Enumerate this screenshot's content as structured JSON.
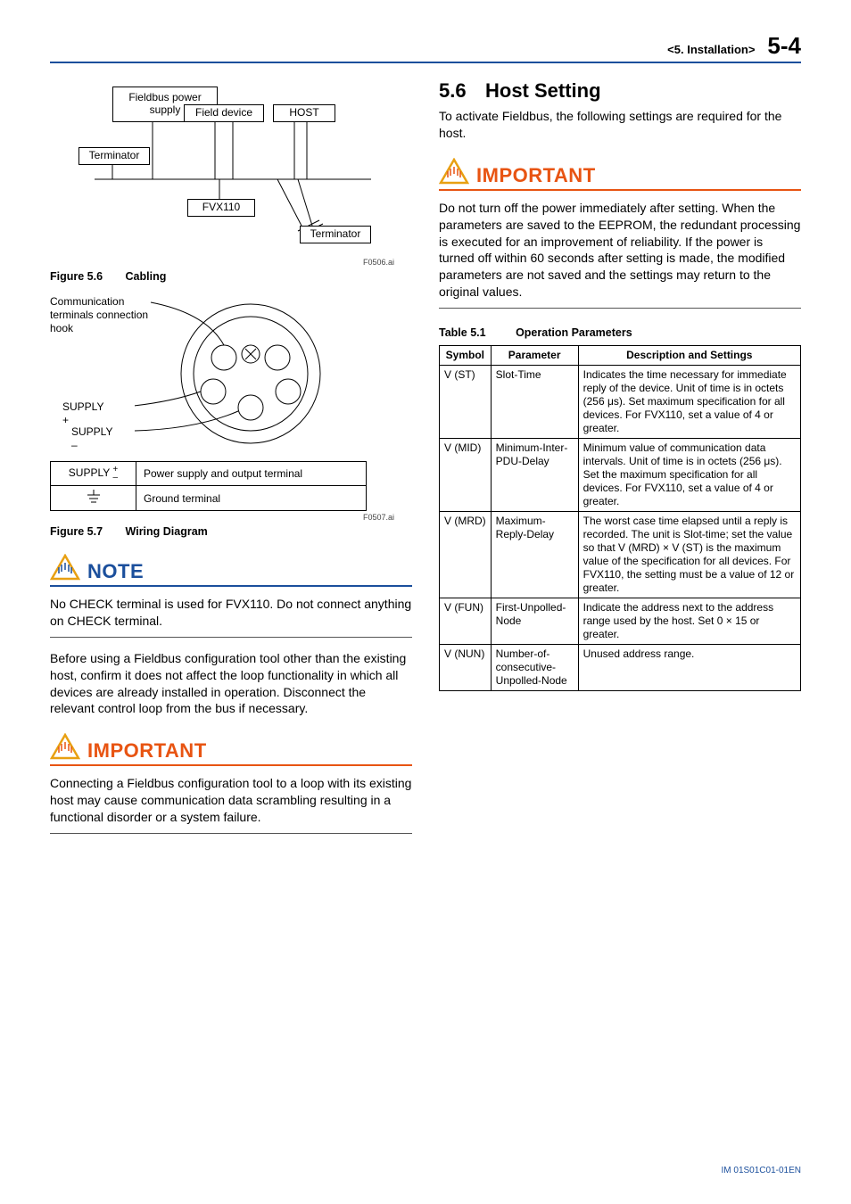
{
  "header": {
    "breadcrumb": "<5.  Installation>",
    "page": "5-4"
  },
  "left": {
    "fig56": {
      "boxes": {
        "fieldbus_power": "Fieldbus power supply",
        "field_device": "Field device",
        "host": "HOST",
        "terminator_l": "Terminator",
        "fvx": "FVX110",
        "terminator_r": "Terminator"
      },
      "ref": "F0506.ai",
      "caption_num": "Figure 5.6",
      "caption_title": "Cabling"
    },
    "fig57": {
      "labels": {
        "comm": "Communication terminals connection hook",
        "supply_plus": "SUPPLY +",
        "supply_minus": "SUPPLY –"
      },
      "supply_table": {
        "row1_label": "SUPPLY",
        "row1_desc": "Power supply and output terminal",
        "row2_label_glyph": "⏚",
        "row2_desc": "Ground terminal"
      },
      "ref": "F0507.ai",
      "caption_num": "Figure 5.7",
      "caption_title": "Wiring Diagram"
    },
    "note": {
      "title": "NOTE",
      "body": "No CHECK terminal is used for FVX110. Do not connect anything on CHECK terminal."
    },
    "para": "Before using a Fieldbus configuration tool other than the existing host, confirm it does not affect the loop functionality in which all devices are already installed in operation. Disconnect the relevant control loop from the bus if necessary.",
    "important": {
      "title": "IMPORTANT",
      "body": "Connecting a Fieldbus configuration tool to a loop with its existing host may cause communication data scrambling resulting in a functional disorder or a system failure."
    }
  },
  "right": {
    "section": {
      "num": "5.6",
      "title": "Host Setting"
    },
    "intro": "To activate Fieldbus, the following settings are required for the host.",
    "important": {
      "title": "IMPORTANT",
      "body": "Do not turn off the power immediately after setting. When the parameters are saved to the EEPROM, the redundant processing is executed for an improvement of reliability. If the power is turned off within 60 seconds after setting is made, the modified parameters are not saved and the settings may return to the original values."
    },
    "table51": {
      "caption_num": "Table 5.1",
      "caption_title": "Operation Parameters",
      "headers": {
        "h1": "Symbol",
        "h2": "Parameter",
        "h3": "Description and Settings"
      },
      "rows": [
        {
          "sym": "V (ST)",
          "param": "Slot-Time",
          "desc": "Indicates the time necessary for immediate reply of the device. Unit of time is in octets (256 μs). Set maximum specification for all devices. For FVX110, set a value of 4 or greater."
        },
        {
          "sym": "V (MID)",
          "param": "Minimum-Inter-PDU-Delay",
          "desc": "Minimum value of communication data intervals. Unit of time is in octets (256 μs). Set the maximum specification for all devices. For FVX110, set a value of 4 or greater."
        },
        {
          "sym": "V (MRD)",
          "param": "Maximum-Reply-Delay",
          "desc": "The worst case time elapsed until a reply is recorded. The unit is Slot-time; set the value so that V (MRD) × V (ST) is the maximum value of the specification for all devices. For FVX110, the setting must be a value of 12 or greater."
        },
        {
          "sym": "V (FUN)",
          "param": "First-Unpolled-Node",
          "desc": "Indicate the address next to the address range used by the host. Set 0 × 15 or greater."
        },
        {
          "sym": "V (NUN)",
          "param": "Number-of-consecutive-Unpolled-Node",
          "desc": "Unused address range."
        }
      ]
    }
  },
  "footer": "IM 01S01C01-01EN"
}
